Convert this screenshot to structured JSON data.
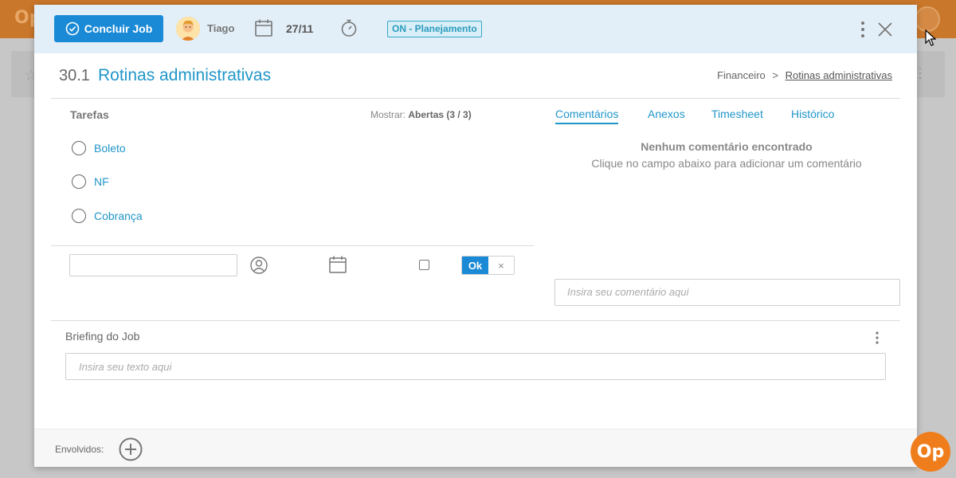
{
  "background_app": {
    "logo": "Op"
  },
  "header": {
    "conclude_button": "Concluir Job",
    "user_name": "Tiago",
    "date": "27/11",
    "status": "ON - Planejamento"
  },
  "job": {
    "number": "30.1",
    "title": "Rotinas administrativas",
    "breadcrumb": {
      "parent": "Financeiro",
      "separator": ">",
      "current": "Rotinas administrativas"
    }
  },
  "tasks": {
    "title": "Tarefas",
    "filter_label": "Mostrar:",
    "filter_value": "Abertas (3 / 3)",
    "items": [
      {
        "label": "Boleto"
      },
      {
        "label": "NF"
      },
      {
        "label": "Cobrança"
      }
    ],
    "new_task": {
      "value": "",
      "ok_label": "Ok",
      "cancel_label": "×"
    }
  },
  "comments": {
    "tabs": [
      {
        "label": "Comentários",
        "active": true
      },
      {
        "label": "Anexos",
        "active": false
      },
      {
        "label": "Timesheet",
        "active": false
      },
      {
        "label": "Histórico",
        "active": false
      }
    ],
    "empty_title": "Nenhum comentário encontrado",
    "empty_hint": "Clique no campo abaixo para adicionar um comentário",
    "input_placeholder": "Insira seu comentário aqui"
  },
  "briefing": {
    "title": "Briefing do Job",
    "input_placeholder": "Insira seu texto aqui"
  },
  "footer": {
    "involved_label": "Envolvidos:"
  },
  "brand_badge": "Op",
  "colors": {
    "accent": "#1b8ad6",
    "link": "#2196c9",
    "header_bg": "#e3eff8",
    "brand_orange": "#f07d1b"
  }
}
